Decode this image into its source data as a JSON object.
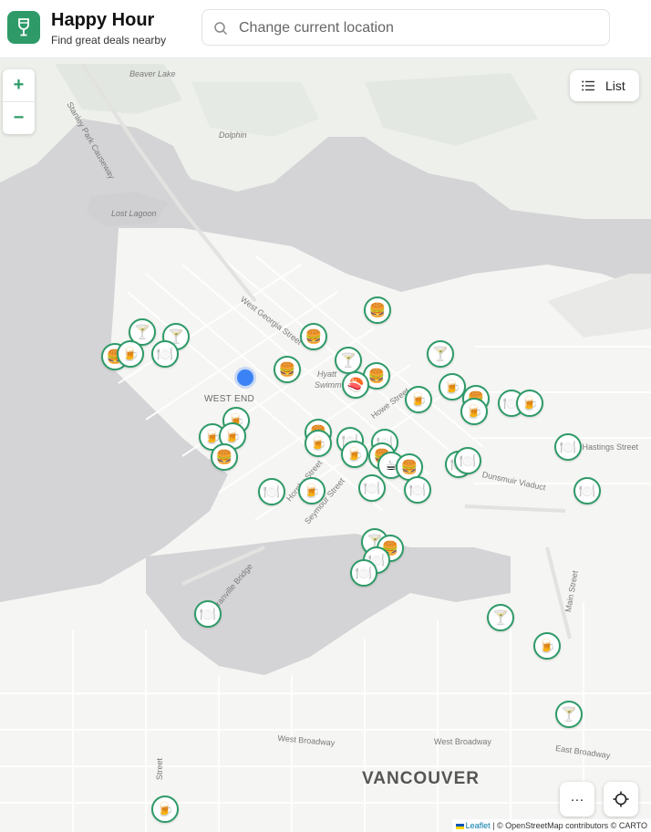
{
  "app": {
    "title": "Happy Hour",
    "subtitle": "Find great deals nearby",
    "logo_icon": "wine-glass-icon",
    "brand_color": "#2e9a68"
  },
  "search": {
    "placeholder": "Change current location",
    "value": ""
  },
  "map_controls": {
    "zoom_in": "+",
    "zoom_out": "−",
    "list_label": "List",
    "more_label": "···"
  },
  "map_labels": {
    "beaver_lake": "Beaver Lake",
    "causeway": "Stanley Park Causeway",
    "dolphin": "Dolphin",
    "lost_lagoon": "Lost Lagoon",
    "west_end": "WEST END",
    "west_georgia": "West Georgia Street",
    "hyatt": "Hyatt",
    "swimm": "Swimm",
    "howe": "Howe Street",
    "hastings": "E Hastings Street",
    "dunsmuir": "Dunsmuir Viaduct",
    "hornby": "Hornby Street",
    "seymour": "Seymour Street",
    "granville_bridge": "Granville Bridge",
    "main": "Main Street",
    "west_broadway_1": "West Broadway",
    "west_broadway_2": "West Broadway",
    "east_broadway": "East Broadway",
    "vancouver": "VANCOUVER",
    "street_sw": "Street"
  },
  "markers": [
    {
      "icon": "🍔",
      "name": "burger"
    },
    {
      "icon": "🍸",
      "name": "cocktail"
    },
    {
      "icon": "🍸",
      "name": "cocktail"
    },
    {
      "icon": "🍺",
      "name": "beer"
    },
    {
      "icon": "🍔",
      "name": "burger"
    },
    {
      "icon": "🍽️",
      "name": "dining"
    },
    {
      "icon": "🍔",
      "name": "burger"
    },
    {
      "icon": "🍔",
      "name": "burger"
    },
    {
      "icon": "🍸",
      "name": "cocktail"
    },
    {
      "icon": "🍔",
      "name": "burger"
    },
    {
      "icon": "🍣",
      "name": "sushi"
    },
    {
      "icon": "🍸",
      "name": "cocktail"
    },
    {
      "icon": "🍺",
      "name": "beer"
    },
    {
      "icon": "🍺",
      "name": "beer"
    },
    {
      "icon": "🍔",
      "name": "burger"
    },
    {
      "icon": "🍺",
      "name": "beer"
    },
    {
      "icon": "🍽️",
      "name": "dining"
    },
    {
      "icon": "🍺",
      "name": "beer"
    },
    {
      "icon": "🍺",
      "name": "beer"
    },
    {
      "icon": "🍺",
      "name": "beer"
    },
    {
      "icon": "🍺",
      "name": "beer"
    },
    {
      "icon": "🍔",
      "name": "burger"
    },
    {
      "icon": "🍔",
      "name": "burger"
    },
    {
      "icon": "🍺",
      "name": "beer"
    },
    {
      "icon": "🍽️",
      "name": "dining"
    },
    {
      "icon": "🍽️",
      "name": "dining"
    },
    {
      "icon": "🍺",
      "name": "beer"
    },
    {
      "icon": "🍔",
      "name": "burger"
    },
    {
      "icon": "☕",
      "name": "coffee"
    },
    {
      "icon": "🍔",
      "name": "burger"
    },
    {
      "icon": "🍽️",
      "name": "dining"
    },
    {
      "icon": "🍽️",
      "name": "dining"
    },
    {
      "icon": "🍽️",
      "name": "dining"
    },
    {
      "icon": "🍺",
      "name": "beer"
    },
    {
      "icon": "🍽️",
      "name": "dining"
    },
    {
      "icon": "🍽️",
      "name": "dining"
    },
    {
      "icon": "🍽️",
      "name": "dining"
    },
    {
      "icon": "🍸",
      "name": "cocktail"
    },
    {
      "icon": "🍔",
      "name": "burger"
    },
    {
      "icon": "🍽️",
      "name": "dining"
    },
    {
      "icon": "🍽️",
      "name": "dining"
    },
    {
      "icon": "🍽️",
      "name": "dining"
    },
    {
      "icon": "🍺",
      "name": "beer"
    },
    {
      "icon": "🍸",
      "name": "cocktail"
    },
    {
      "icon": "🍸",
      "name": "cocktail"
    },
    {
      "icon": "🍺",
      "name": "beer"
    },
    {
      "icon": "🍽️",
      "name": "dining"
    }
  ],
  "attribution": {
    "leaflet": "Leaflet",
    "rest": "| © OpenStreetMap contributors © CARTO"
  }
}
